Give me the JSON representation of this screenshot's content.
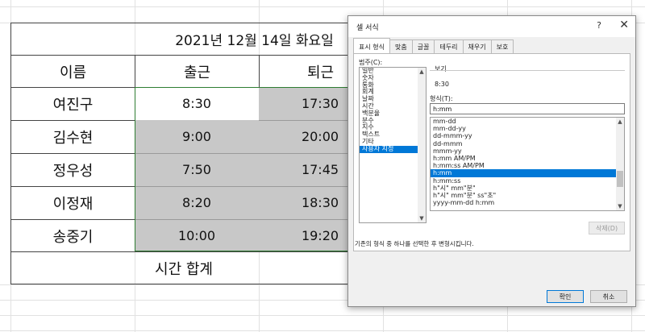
{
  "sheet": {
    "title": "2021년 12월 14일 화요일",
    "headers": {
      "name": "이름",
      "in": "출근",
      "out": "퇴근"
    },
    "rows": [
      {
        "name": "여진구",
        "in": "8:30",
        "out": "17:30"
      },
      {
        "name": "김수현",
        "in": "9:00",
        "out": "20:00"
      },
      {
        "name": "정우성",
        "in": "7:50",
        "out": "17:45"
      },
      {
        "name": "이정재",
        "in": "8:20",
        "out": "18:30"
      },
      {
        "name": "송중기",
        "in": "10:00",
        "out": "19:20"
      }
    ],
    "total_label": "시간 합계"
  },
  "dialog": {
    "title": "셀 서식",
    "help": "?",
    "close": "✕",
    "tabs": [
      "표시 형식",
      "맞춤",
      "글꼴",
      "테두리",
      "채우기",
      "보호"
    ],
    "category_label": "범주(C):",
    "categories": [
      "일반",
      "숫자",
      "통화",
      "회계",
      "날짜",
      "시간",
      "백분율",
      "분수",
      "지수",
      "텍스트",
      "기타",
      "사용자 지정"
    ],
    "selected_category": "사용자 지정",
    "preview_label": "보기",
    "preview_value": "8:30",
    "format_label": "형식(T):",
    "format_value": "h:mm",
    "formats": [
      "mm-dd",
      "mm-dd-yy",
      "dd-mmm-yy",
      "dd-mmm",
      "mmm-yy",
      "h:mm AM/PM",
      "h:mm:ss AM/PM",
      "h:mm",
      "h:mm:ss",
      "h\"시\" mm\"분\"",
      "h\"시\" mm\"분\" ss\"초\"",
      "yyyy-mm-dd h:mm"
    ],
    "selected_format": "h:mm",
    "delete_button": "삭제(D)",
    "description": "기존의 형식 중 하나를 선택한 후 변형시킵니다.",
    "ok_button": "확인",
    "cancel_button": "취소",
    "colors": {
      "selection": "#0078d7",
      "cell_gray": "#c8c8c8",
      "selection_border": "#2e7d32"
    }
  }
}
